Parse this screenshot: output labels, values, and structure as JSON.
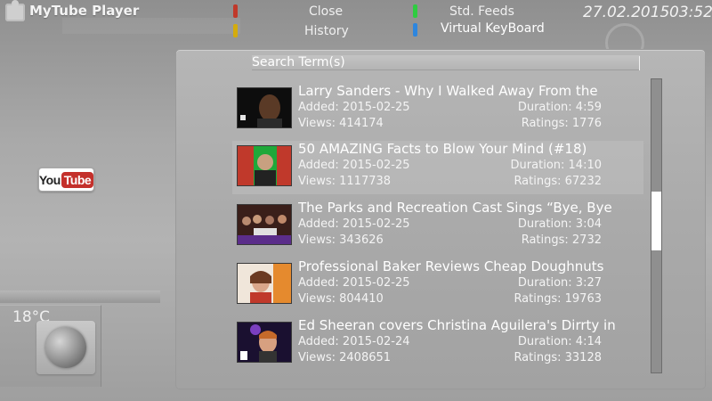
{
  "app": {
    "title": "MyTube Player"
  },
  "colors": {
    "red_key": "#c0392b",
    "green_key": "#2ecc40",
    "yellow_key": "#d4ac0d",
    "blue_key": "#2e86de",
    "youtube_red": "#c4302b"
  },
  "keys": {
    "close": "Close",
    "history": "History",
    "std_feeds": "Std. Feeds",
    "virtual_keyboard": "Virtual KeyBoard"
  },
  "datetime": {
    "date": "27.02.2015",
    "time": "03:52"
  },
  "logo": {
    "you": "You",
    "tube": "Tube"
  },
  "weather": {
    "temperature": "18°C",
    "icon": "moon-icon"
  },
  "search": {
    "placeholder": "Search Term(s)"
  },
  "scroll": {
    "position_fraction": 0.48
  },
  "results": [
    {
      "title": "Larry Sanders - Why I Walked Away From the",
      "added": "Added: 2015-02-25",
      "duration": "Duration: 4:59",
      "views": "Views: 414174",
      "ratings": "Ratings: 1776"
    },
    {
      "title": "50 AMAZING Facts to Blow Your Mind (#18)",
      "added": "Added: 2015-02-25",
      "duration": "Duration: 14:10",
      "views": "Views: 1117738",
      "ratings": "Ratings: 67232"
    },
    {
      "title": "The Parks and Recreation Cast Sings “Bye, Bye",
      "added": "Added: 2015-02-25",
      "duration": "Duration: 3:04",
      "views": "Views: 343626",
      "ratings": "Ratings: 2732"
    },
    {
      "title": "Professional Baker Reviews Cheap Doughnuts",
      "added": "Added: 2015-02-25",
      "duration": "Duration: 3:27",
      "views": "Views: 804410",
      "ratings": "Ratings: 19763"
    },
    {
      "title": "Ed Sheeran covers Christina Aguilera's Dirrty in",
      "added": "Added: 2015-02-24",
      "duration": "Duration: 4:14",
      "views": "Views: 2408651",
      "ratings": "Ratings: 33128"
    }
  ]
}
